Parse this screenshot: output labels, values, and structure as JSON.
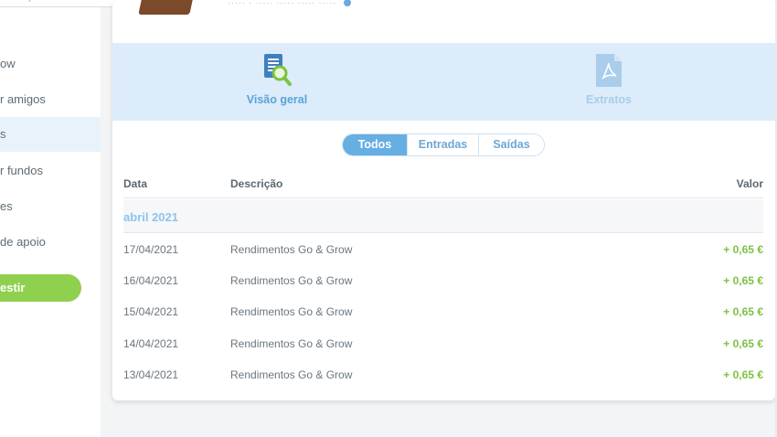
{
  "browser": {
    "url_text": "··· ·· ··/··· ··········· ·· ··· ·· ·········· ·· · ···",
    "icons": "☆ ⋮"
  },
  "sidebar": {
    "items": [
      {
        "label": "ow",
        "active": false
      },
      {
        "label": "r amigos",
        "active": false
      },
      {
        "label": "s",
        "active": true
      },
      {
        "label": "r fundos",
        "active": false
      },
      {
        "label": "es",
        "active": false
      },
      {
        "label": "de apoio",
        "active": false
      }
    ],
    "invest_label": "estir"
  },
  "card": {
    "top_text": "····· · ····· ····· ····· ·····"
  },
  "tabs": {
    "overview": {
      "label": "Visão geral",
      "icon": "document-search-icon"
    },
    "statements": {
      "label": "Extratos",
      "icon": "pdf-document-icon"
    }
  },
  "filters": {
    "items": [
      "Todos",
      "Entradas",
      "Saídas"
    ],
    "active": "Todos"
  },
  "table": {
    "headers": {
      "date": "Data",
      "description": "Descrição",
      "value": "Valor"
    },
    "month": "abril 2021",
    "rows": [
      {
        "date": "17/04/2021",
        "description": "Rendimentos Go & Grow",
        "value": "+ 0,65 €"
      },
      {
        "date": "16/04/2021",
        "description": "Rendimentos Go & Grow",
        "value": "+ 0,65 €"
      },
      {
        "date": "15/04/2021",
        "description": "Rendimentos Go & Grow",
        "value": "+ 0,65 €"
      },
      {
        "date": "14/04/2021",
        "description": "Rendimentos Go & Grow",
        "value": "+ 0,65 €"
      },
      {
        "date": "13/04/2021",
        "description": "Rendimentos Go & Grow",
        "value": "+ 0,65 €"
      }
    ]
  },
  "colors": {
    "accent_blue": "#67aee3",
    "positive_green": "#7cc242",
    "invest_green": "#8fd14f",
    "band_bg": "#dcecfa"
  }
}
